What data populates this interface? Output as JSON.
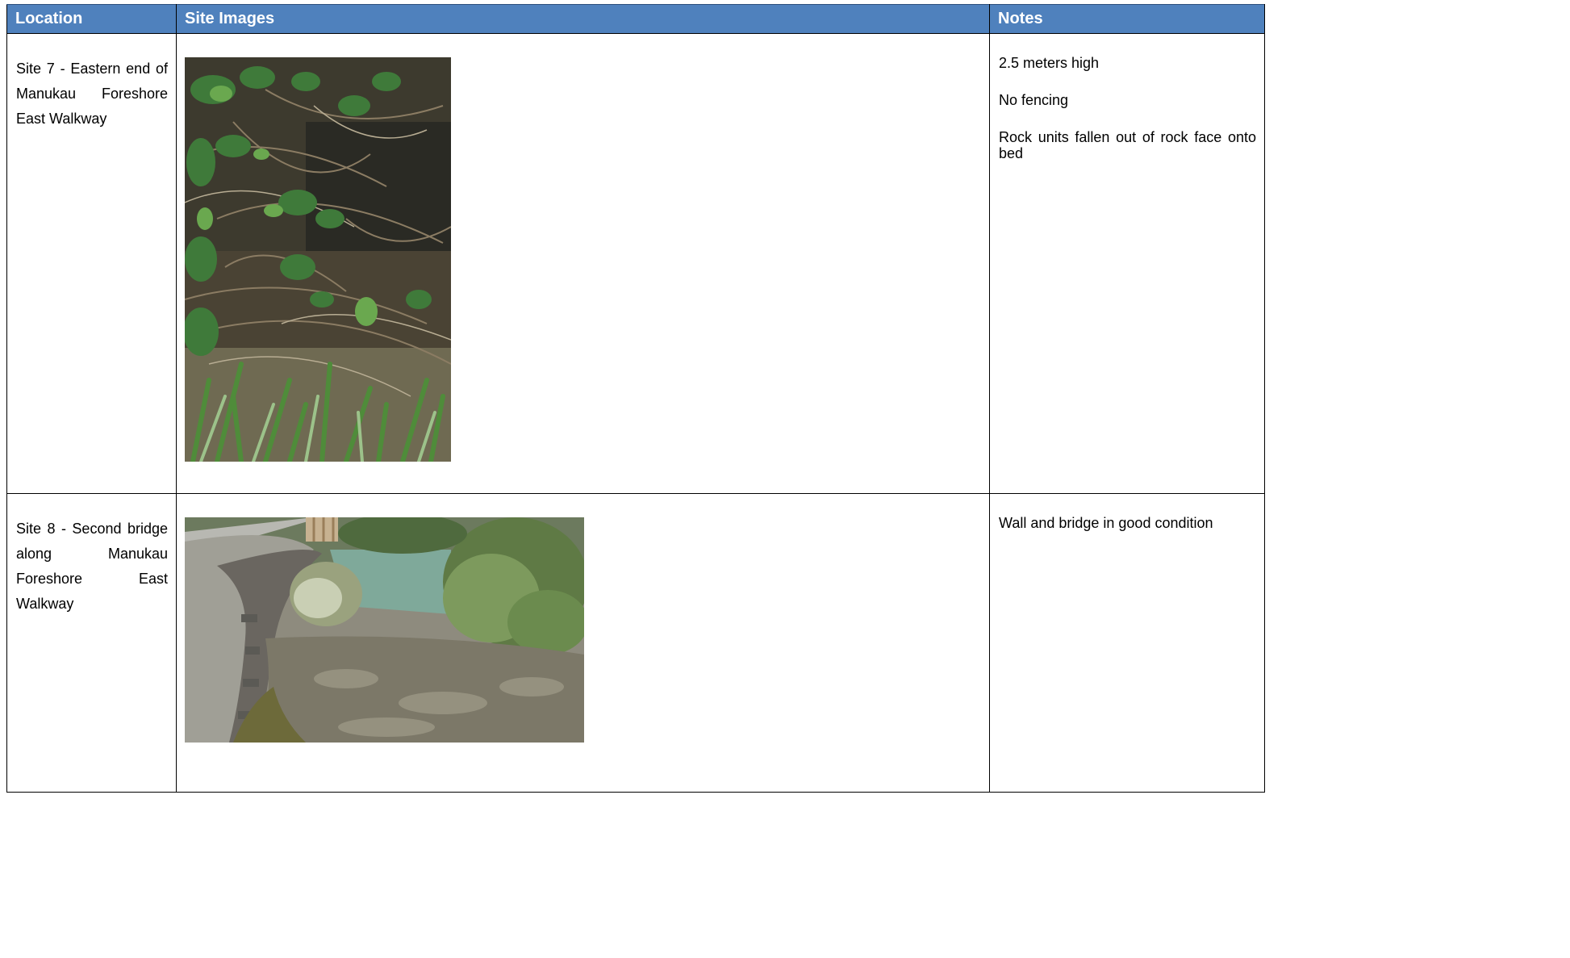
{
  "table": {
    "headers": {
      "location": "Location",
      "site_images": "Site Images",
      "notes": "Notes"
    },
    "rows": [
      {
        "location": "Site 7 - Eastern  end of Manukau Foreshore East Walkway",
        "notes": [
          "2.5 meters high",
          "No fencing",
          "Rock units fallen out of rock face onto bed"
        ]
      },
      {
        "location": "Site 8 - Second bridge along Manukau Foreshore East Walkway",
        "notes": [
          "Wall and bridge in good condition"
        ]
      }
    ]
  },
  "colors": {
    "header_background": "#4f81bd",
    "header_text": "#ffffff",
    "border": "#000000"
  }
}
